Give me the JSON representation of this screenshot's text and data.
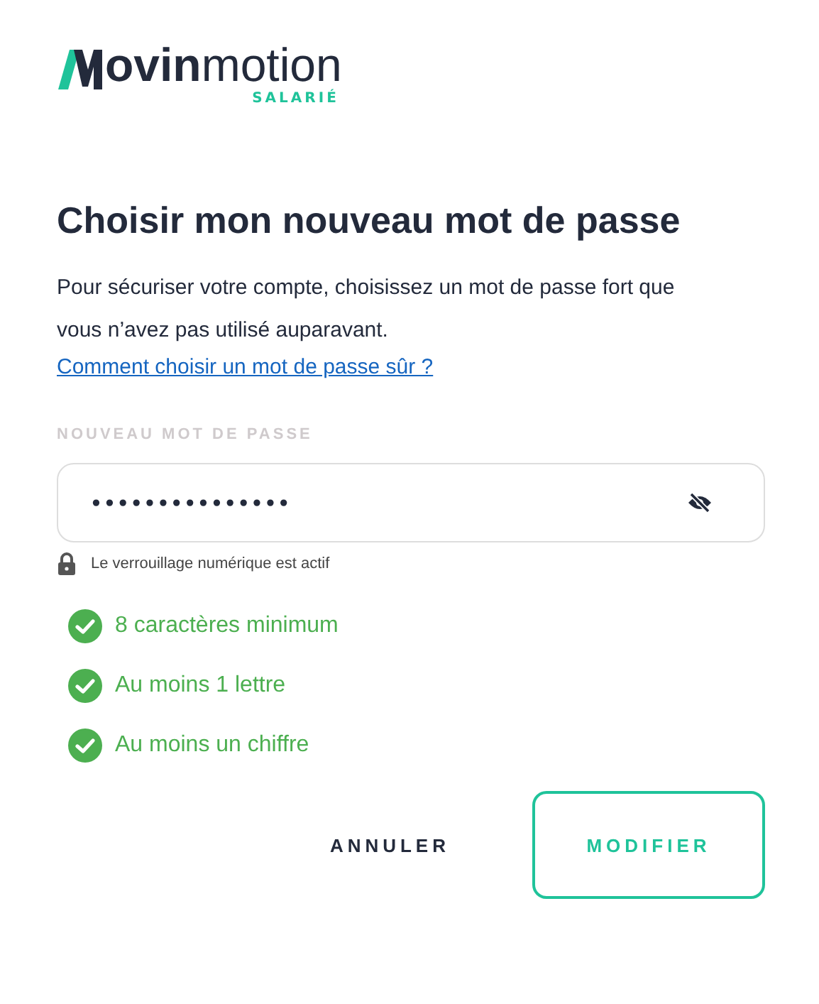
{
  "logo": {
    "bold": "ovin",
    "light": "motion",
    "tagline": "SALARIÉ"
  },
  "title": "Choisir mon nouveau mot de passe",
  "intro": "Pour sécuriser votre compte, choisissez un mot de passe fort que vous n’avez pas utilisé auparavant.",
  "help_link": "Comment choisir un mot de passe sûr ?",
  "password": {
    "label": "NOUVEAU MOT DE PASSE",
    "value": "•••••••••••••••",
    "visible": false
  },
  "caps_notice": "Le verrouillage numérique est actif",
  "rules": [
    {
      "text": "8 caractères minimum",
      "checked": true
    },
    {
      "text": "Au moins 1 lettre",
      "checked": true
    },
    {
      "text": "Au moins un chiffre",
      "checked": true
    }
  ],
  "buttons": [
    {
      "label": "ANNULER",
      "kind": "text"
    },
    {
      "label": "MODIFIER",
      "kind": "outline"
    }
  ]
}
